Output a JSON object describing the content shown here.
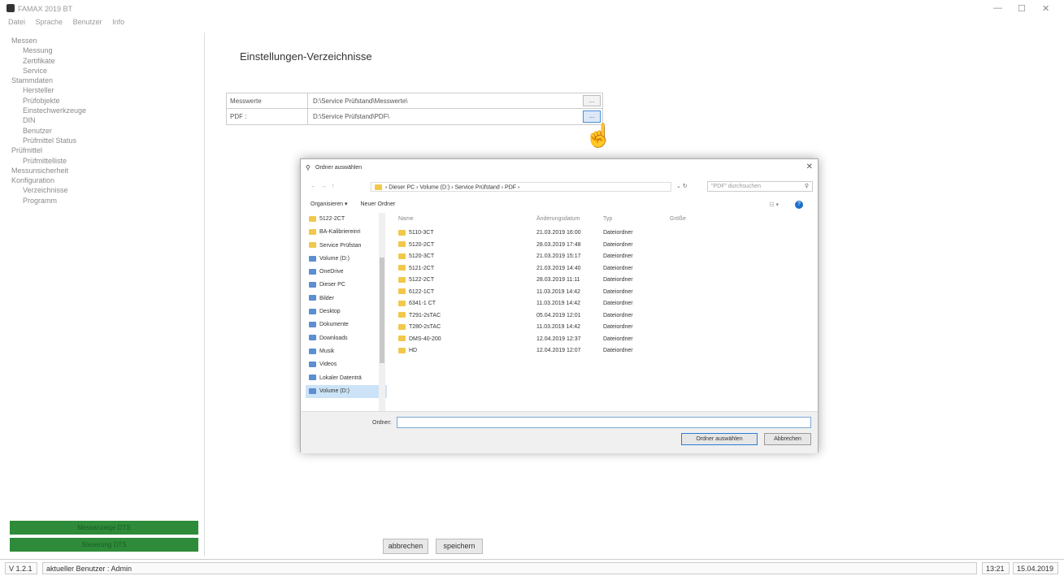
{
  "window": {
    "title": "FAMAX 2019 BT"
  },
  "menu": [
    "Datei",
    "Sprache",
    "Benutzer",
    "Info"
  ],
  "tree": [
    {
      "label": "Messen",
      "level": 0
    },
    {
      "label": "Messung",
      "level": 1
    },
    {
      "label": "Zertifikate",
      "level": 1
    },
    {
      "label": "Service",
      "level": 1
    },
    {
      "label": "Stammdaten",
      "level": 0
    },
    {
      "label": "Hersteller",
      "level": 1
    },
    {
      "label": "Prüfobjekte",
      "level": 1
    },
    {
      "label": "Einstechwerkzeuge",
      "level": 1
    },
    {
      "label": "DIN",
      "level": 1
    },
    {
      "label": "Benutzer",
      "level": 1
    },
    {
      "label": "Prüfmittel Status",
      "level": 1
    },
    {
      "label": "Prüfmittel",
      "level": 0
    },
    {
      "label": "Prüfmittelliste",
      "level": 1
    },
    {
      "label": "Messunsicherheit",
      "level": 0
    },
    {
      "label": "Konfiguration",
      "level": 0
    },
    {
      "label": "Verzeichnisse",
      "level": 1
    },
    {
      "label": "Programm",
      "level": 1
    }
  ],
  "left_buttons": {
    "btn1": "Messanzeige DTS",
    "btn2": "Steuerung DTS"
  },
  "main": {
    "title": "Einstellungen-Verzeichnisse",
    "rows": [
      {
        "label": "Messwerte",
        "value": "D:\\Service Prüfstand\\Messwerte\\",
        "button": "..."
      },
      {
        "label": "PDF :",
        "value": "D:\\Service Prüfstand\\PDF\\",
        "button": "..."
      }
    ],
    "cancel": "abbrechen",
    "save": "speichern"
  },
  "status": {
    "version": "V 1.2.1",
    "user": "aktueller Benutzer : Admin",
    "time": "13:21",
    "date": "15.04.2019"
  },
  "dialog": {
    "title": "Ordner auswählen",
    "path": "› Dieser PC › Volume (D:) › Service Prüfstand › PDF ›",
    "search_placeholder": "\"PDF\" durchsuchen",
    "organize": "Organisieren ▾",
    "new_folder": "Neuer Ordner",
    "nav": [
      {
        "label": "5122-2CT",
        "icon": "folder-icon"
      },
      {
        "label": "BA-Kalibriereinri",
        "icon": "folder-icon"
      },
      {
        "label": "Service Prüfstan",
        "icon": "folder-icon"
      },
      {
        "label": "Volume (D:)",
        "icon": "drive-icon"
      },
      {
        "label": "OneDrive",
        "icon": "cloud-icon"
      },
      {
        "label": "Dieser PC",
        "icon": "computer-icon"
      },
      {
        "label": "Bilder",
        "icon": "pictures-icon"
      },
      {
        "label": "Desktop",
        "icon": "desktop-icon"
      },
      {
        "label": "Dokumente",
        "icon": "documents-icon"
      },
      {
        "label": "Downloads",
        "icon": "download-icon"
      },
      {
        "label": "Musik",
        "icon": "music-icon"
      },
      {
        "label": "Videos",
        "icon": "video-icon"
      },
      {
        "label": "Lokaler Datenträ",
        "icon": "drive-icon"
      },
      {
        "label": "Volume (D:)",
        "icon": "drive-icon"
      }
    ],
    "columns": {
      "name": "Name",
      "date": "Änderungsdatum",
      "type": "Typ",
      "size": "Größe"
    },
    "files": [
      {
        "name": "5110-3CT",
        "date": "21.03.2019 16:00",
        "type": "Dateiordner"
      },
      {
        "name": "5120-2CT",
        "date": "28.03.2019 17:48",
        "type": "Dateiordner"
      },
      {
        "name": "5120-3CT",
        "date": "21.03.2019 15:17",
        "type": "Dateiordner"
      },
      {
        "name": "5121-2CT",
        "date": "21.03.2019 14:40",
        "type": "Dateiordner"
      },
      {
        "name": "5122-2CT",
        "date": "28.03.2019 11:11",
        "type": "Dateiordner"
      },
      {
        "name": "6122-1CT",
        "date": "11.03.2019 14:42",
        "type": "Dateiordner"
      },
      {
        "name": "6341-1 CT",
        "date": "11.03.2019 14:42",
        "type": "Dateiordner"
      },
      {
        "name": "T291-2sTAC",
        "date": "05.04.2019 12:01",
        "type": "Dateiordner"
      },
      {
        "name": "T280-2sTAC",
        "date": "11.03.2019 14:42",
        "type": "Dateiordner"
      },
      {
        "name": "DMS-40-200",
        "date": "12.04.2019 12:37",
        "type": "Dateiordner"
      },
      {
        "name": "HD",
        "date": "12.04.2019 12:07",
        "type": "Dateiordner"
      }
    ],
    "folder_label": "Ordner:",
    "folder_value": "",
    "select_btn": "Ordner auswählen",
    "cancel_btn": "Abbrechen"
  }
}
